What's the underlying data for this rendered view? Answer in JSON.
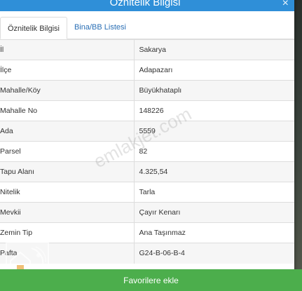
{
  "modal": {
    "title": "Öznitelik Bilgisi",
    "close_glyph": "×"
  },
  "tabs": [
    {
      "label": "Öznitelik Bilgisi",
      "active": true
    },
    {
      "label": "Bina/BB Listesi",
      "active": false
    }
  ],
  "attributes": [
    {
      "key": "İl",
      "value": "Sakarya"
    },
    {
      "key": "İlçe",
      "value": "Adapazarı"
    },
    {
      "key": "Mahalle/Köy",
      "value": "Büyükhataplı"
    },
    {
      "key": "Mahalle No",
      "value": "148226"
    },
    {
      "key": "Ada",
      "value": "5559"
    },
    {
      "key": "Parsel",
      "value": "82"
    },
    {
      "key": "Tapu Alanı",
      "value": "4.325,54"
    },
    {
      "key": "Nitelik",
      "value": "Tarla"
    },
    {
      "key": "Mevkii",
      "value": "Çayır Kenarı"
    },
    {
      "key": "Zemin Tip",
      "value": "Ana Taşınmaz"
    },
    {
      "key": "Pafta",
      "value": "G24-B-06-B-4"
    }
  ],
  "footer": {
    "button_label": "Favorilere ekle"
  },
  "watermark": {
    "text": "emlakjet.com"
  },
  "colors": {
    "header": "#2f8fd8",
    "tab_link": "#2a6fb5",
    "footer_button": "#4cae4c"
  },
  "icons": [
    "close-icon",
    "watermark-logo"
  ]
}
